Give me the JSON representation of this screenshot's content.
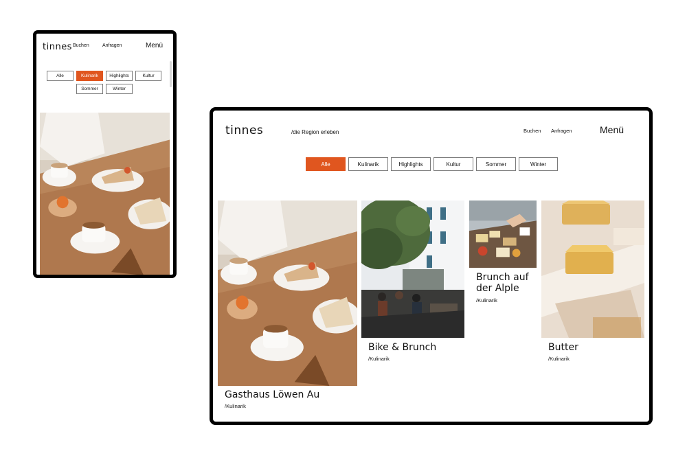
{
  "brand": {
    "logo": "tinnes",
    "tagline": "/die Region erleben",
    "accent": "#e0561f"
  },
  "nav": {
    "buchen": "Buchen",
    "anfragen": "Anfragen",
    "menu": "Menü"
  },
  "filters": [
    {
      "label": "Alle",
      "active": false
    },
    {
      "label": "Kulinarik",
      "active": true
    },
    {
      "label": "Highlights",
      "active": false
    },
    {
      "label": "Kultur",
      "active": false
    },
    {
      "label": "Sommer",
      "active": false
    },
    {
      "label": "Winter",
      "active": false
    }
  ],
  "tablet_filters": [
    {
      "label": "Alle",
      "active": true
    },
    {
      "label": "Kulinarik",
      "active": false
    },
    {
      "label": "Highlights",
      "active": false
    },
    {
      "label": "Kultur",
      "active": false
    },
    {
      "label": "Sommer",
      "active": false
    },
    {
      "label": "Winter",
      "active": false
    }
  ],
  "cards": [
    {
      "title": "Gasthaus Löwen Au",
      "category": "/Kulinarik",
      "image": "cafe-cake-photo"
    },
    {
      "title": "Bike & Brunch",
      "category": "/Kulinarik",
      "image": "courtyard-photo"
    },
    {
      "title": "Brunch auf der Alple",
      "category": "/Kulinarik",
      "image": "platter-photo"
    },
    {
      "title": "Butter",
      "category": "/Kulinarik",
      "image": "butter-photo"
    }
  ]
}
